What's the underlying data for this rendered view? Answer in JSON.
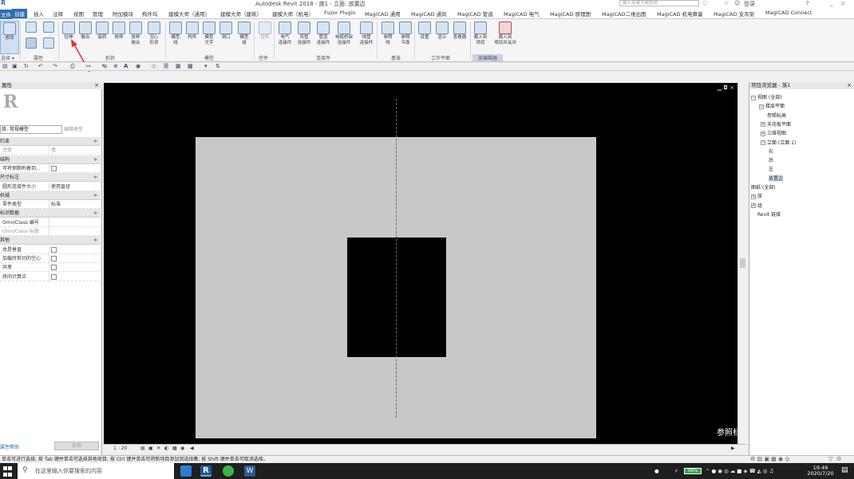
{
  "window": {
    "title": "Autodesk Revit 2018 -   族1 - 立面: 放置边",
    "search_placeholder": "键入关键字或短语",
    "user": "登录",
    "help": "?"
  },
  "tabs": [
    {
      "label": "文件"
    },
    {
      "label": "创建"
    },
    {
      "label": "插入"
    },
    {
      "label": "注释"
    },
    {
      "label": "视图"
    },
    {
      "label": "管理"
    },
    {
      "label": "附加模块"
    },
    {
      "label": "构件坞"
    },
    {
      "label": "建模大师（通用）"
    },
    {
      "label": "建模大师（建筑）"
    },
    {
      "label": "建模大师（机电）"
    },
    {
      "label": "Fuzor Plugin"
    },
    {
      "label": "MagiCAD 通用"
    },
    {
      "label": "MagiCAD 通风"
    },
    {
      "label": "MagiCAD 管道"
    },
    {
      "label": "MagiCAD 电气"
    },
    {
      "label": "MagiCAD 原理图"
    },
    {
      "label": "MagiCAD二维出图"
    },
    {
      "label": "MagiCAD 机电算量"
    },
    {
      "label": "MagiCAD 支吊架"
    },
    {
      "label": "MagiCAD Connect"
    }
  ],
  "ribbon": {
    "buttons": [
      {
        "label": "修改",
        "icon": "modify-icon"
      },
      {
        "label": "拉伸",
        "icon": "extrusion-icon"
      },
      {
        "label": "融合",
        "icon": "blend-icon"
      },
      {
        "label": "旋转",
        "icon": "revolve-icon"
      },
      {
        "label": "放样",
        "icon": "sweep-icon"
      },
      {
        "label": "放样\n融合",
        "icon": "swept-blend-icon"
      },
      {
        "label": "空心\n形状",
        "icon": "void-form-icon"
      },
      {
        "label": "模型\n线",
        "icon": "model-line-icon"
      },
      {
        "label": "构件",
        "icon": "component-icon"
      },
      {
        "label": "模型\n文字",
        "icon": "model-text-icon"
      },
      {
        "label": "洞口",
        "icon": "opening-icon"
      },
      {
        "label": "模型\n组",
        "icon": "model-group-icon"
      },
      {
        "label": "控件",
        "icon": "control-icon"
      },
      {
        "label": "电气\n连接件",
        "icon": "electrical-connector-icon"
      },
      {
        "label": "风管\n连接件",
        "icon": "duct-connector-icon"
      },
      {
        "label": "管道\n连接件",
        "icon": "pipe-connector-icon"
      },
      {
        "label": "电缆桥架\n连接件",
        "icon": "cable-tray-connector-icon"
      },
      {
        "label": "线管\n连接件",
        "icon": "conduit-connector-icon"
      },
      {
        "label": "参照\n线",
        "icon": "reference-line-icon"
      },
      {
        "label": "参照\n平面",
        "icon": "reference-plane-icon"
      },
      {
        "label": "设置",
        "icon": "set-icon"
      },
      {
        "label": "显示",
        "icon": "show-icon"
      },
      {
        "label": "查看器",
        "icon": "viewer-icon"
      },
      {
        "label": "载入到\n项目",
        "icon": "load-into-project-icon"
      },
      {
        "label": "载入到\n项目并关闭",
        "icon": "load-close-icon"
      }
    ],
    "panels": {
      "select": "选择 ▾",
      "properties": "属性",
      "forms": "形状",
      "model": "模型",
      "control": "控件",
      "connectors": "连接件",
      "datum": "基准",
      "work_plane": "工作平面",
      "family_editor": "族编辑器"
    }
  },
  "properties": {
    "title": "属性",
    "close": "×",
    "logo": "R",
    "type_selector": "族: 常规模型",
    "edit_type": "编辑类型",
    "rows": [
      {
        "k": "约束",
        "group": true
      },
      {
        "k": "主体",
        "v": "墙",
        "gray": true
      },
      {
        "k": "结构",
        "group": true
      },
      {
        "k": "可将钢筋附着到...",
        "v": "",
        "chk": true
      },
      {
        "k": "尺寸标注",
        "group": true
      },
      {
        "k": "圆形连接件大小",
        "v": "使用直径"
      },
      {
        "k": "机械",
        "group": true
      },
      {
        "k": "零件类型",
        "v": "标准"
      },
      {
        "k": "标识数据",
        "group": true
      },
      {
        "k": "OmniClass 编号",
        "v": ""
      },
      {
        "k": "OmniClass 标题",
        "v": "",
        "gray": true
      },
      {
        "k": "其他",
        "group": true
      },
      {
        "k": "总是垂直",
        "v": "",
        "chk": true
      },
      {
        "k": "加载时剪切的空心",
        "v": "",
        "chk": true
      },
      {
        "k": "共享",
        "v": "",
        "chk": true
      },
      {
        "k": "房间计算点",
        "v": "",
        "chk": true
      }
    ],
    "help": "属性帮助",
    "apply": "应用"
  },
  "view": {
    "reference_label": "参照标",
    "scale": "1 : 20",
    "minimize": "▁ ◘ ×"
  },
  "project_browser": {
    "title": "项目浏览器 - 族1",
    "nodes": [
      {
        "label": "视图 (全部)",
        "exp": "−"
      },
      {
        "label": "楼层平面",
        "exp": "−"
      },
      {
        "label": "参照标高"
      },
      {
        "label": "天花板平面",
        "exp": "+"
      },
      {
        "label": "三维视图",
        "exp": "+"
      },
      {
        "label": "立面 (立面 1)",
        "exp": "−"
      },
      {
        "label": "右"
      },
      {
        "label": "后"
      },
      {
        "label": "左"
      },
      {
        "label": "放置边",
        "sel": true
      },
      {
        "label": "图纸 (全部)"
      },
      {
        "label": "族",
        "exp": "+"
      },
      {
        "label": "组",
        "exp": "+"
      },
      {
        "label": "Revit 链接"
      }
    ]
  },
  "status": {
    "message": "单击可进行选择; 按 Tab 键并单击可选择其他项目; 按 Ctrl 键并单击可将新项目添加到选择集; 按 Shift 键并单击可取消选择。",
    "filter": ":0"
  },
  "taskbar": {
    "search_placeholder": "在这里输入你要搜索的内容",
    "battery": "99%",
    "time": "19:49",
    "date": "2020/7/20"
  }
}
